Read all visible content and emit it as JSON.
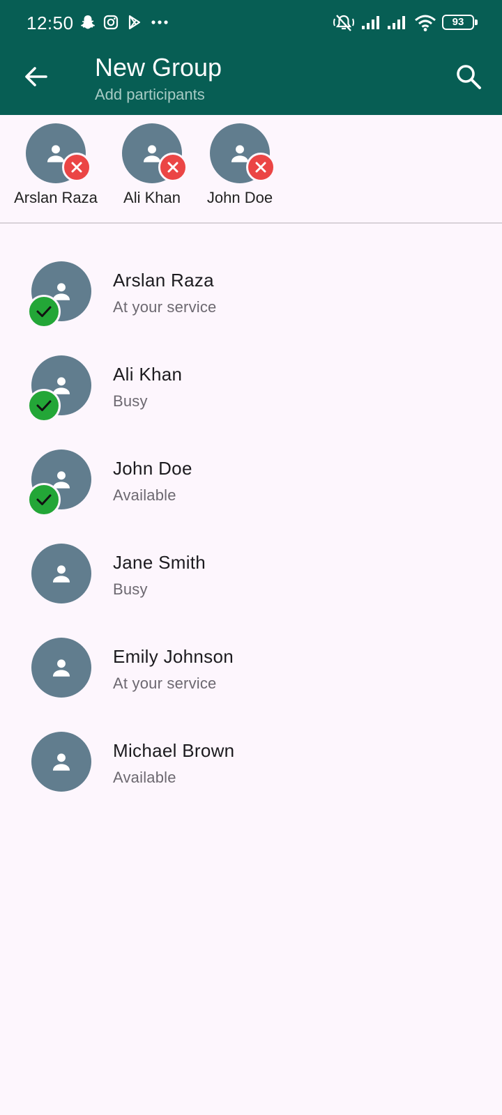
{
  "status_bar": {
    "time": "12:50",
    "battery": "93"
  },
  "app_bar": {
    "title": "New Group",
    "subtitle": "Add participants"
  },
  "selected": [
    {
      "name": "Arslan Raza"
    },
    {
      "name": "Ali Khan"
    },
    {
      "name": "John Doe"
    }
  ],
  "contacts": [
    {
      "name": "Arslan Raza",
      "status": "At your service",
      "selected": true
    },
    {
      "name": "Ali Khan",
      "status": "Busy",
      "selected": true
    },
    {
      "name": "John Doe",
      "status": "Available",
      "selected": true
    },
    {
      "name": "Jane Smith",
      "status": "Busy",
      "selected": false
    },
    {
      "name": "Emily Johnson",
      "status": "At your service",
      "selected": false
    },
    {
      "name": "Michael Brown",
      "status": "Available",
      "selected": false
    }
  ],
  "colors": {
    "primary": "#075e54",
    "avatar": "#617d8e",
    "remove": "#eb4545",
    "check": "#23a637",
    "background": "#fdf6fd"
  }
}
